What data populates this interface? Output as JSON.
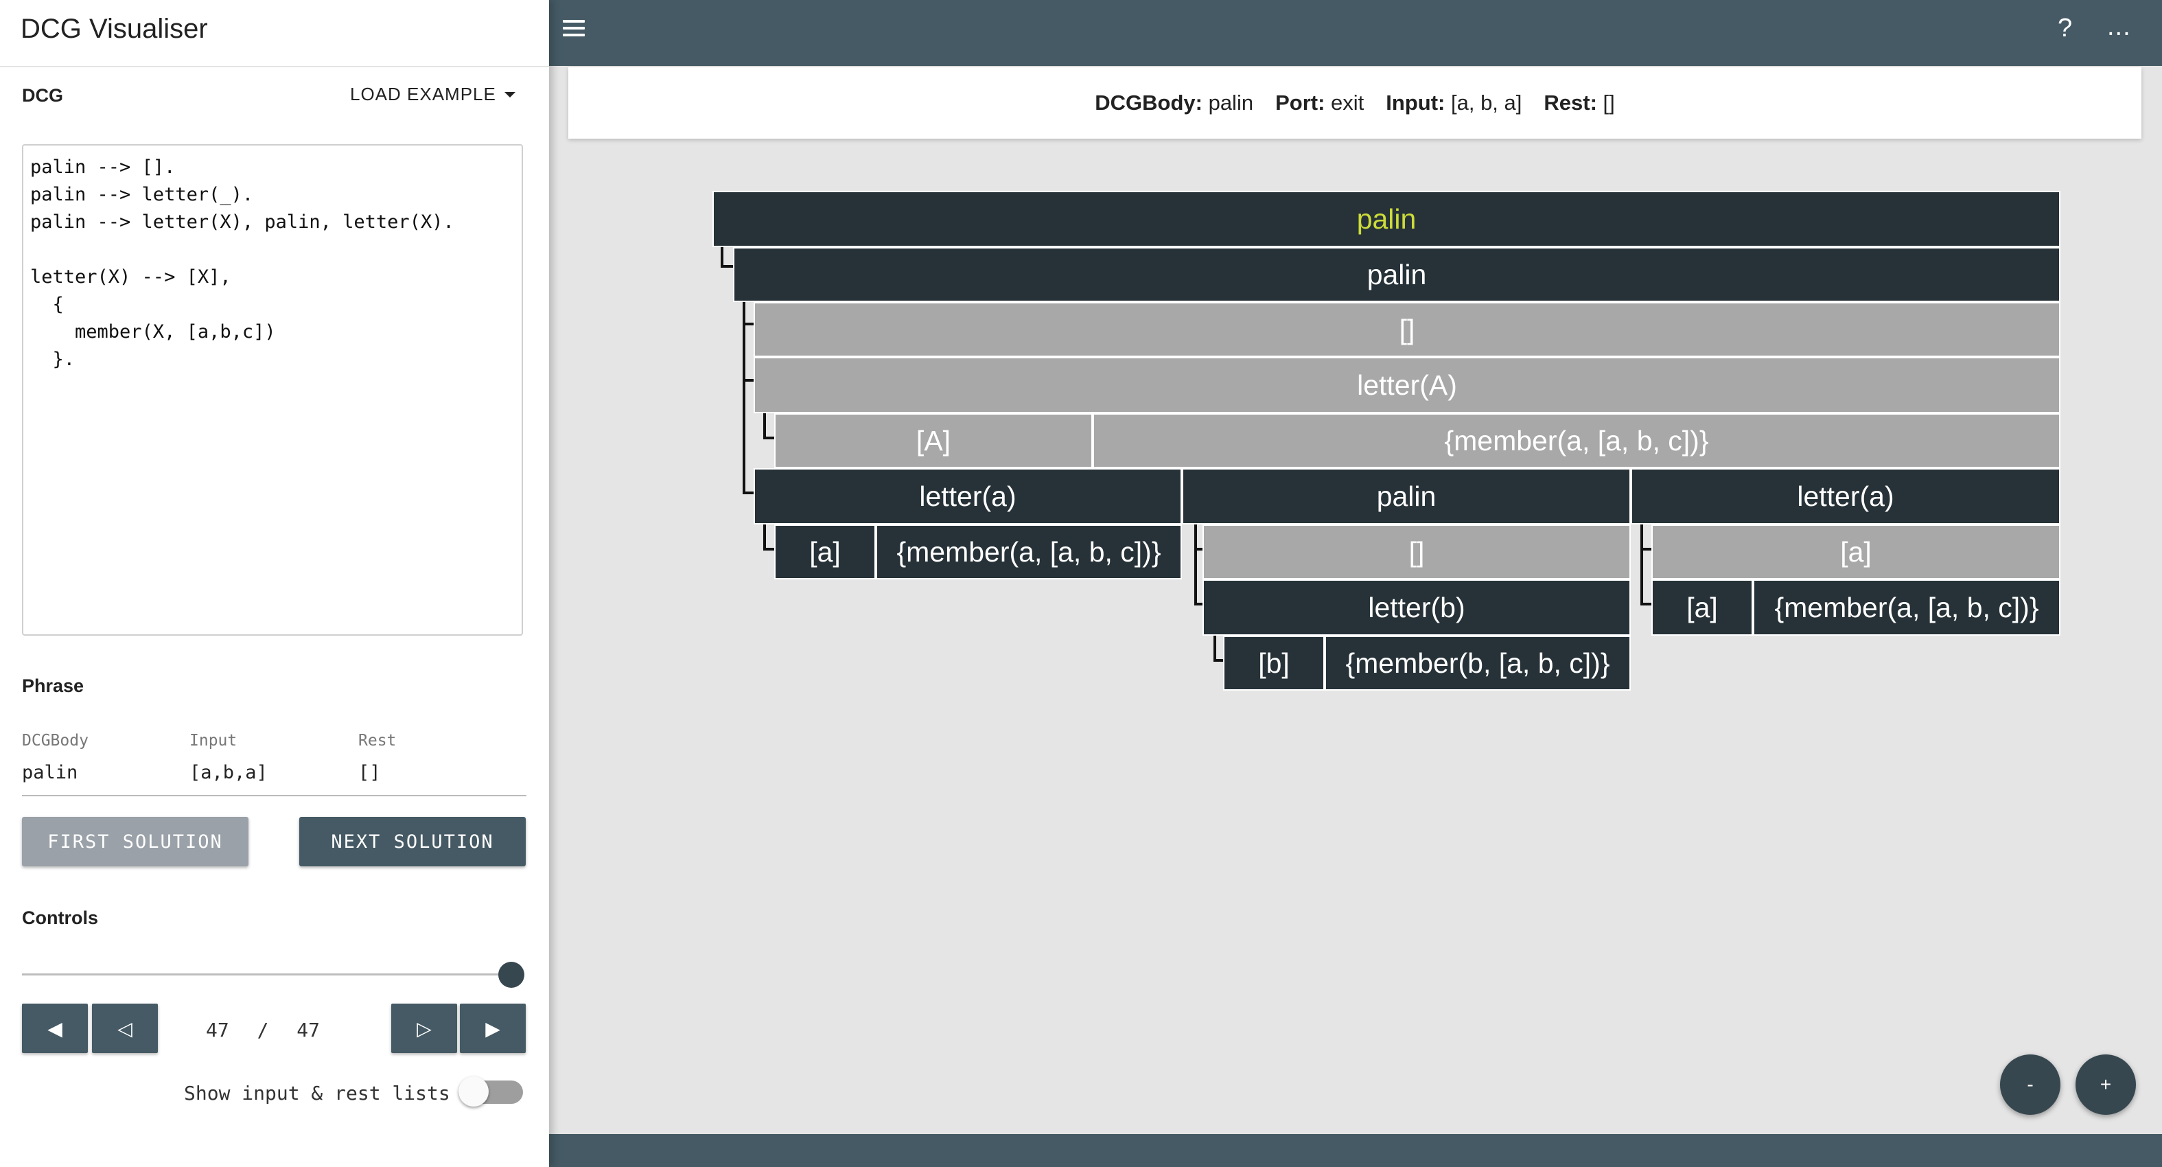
{
  "app": {
    "title": "DCG Visualiser"
  },
  "left_panel": {
    "dcg_label": "DCG",
    "load_example_label": "LOAD EXAMPLE",
    "dcg_code": "palin --> [].\npalin --> letter(_).\npalin --> letter(X), palin, letter(X).\n\nletter(X) --> [X],\n  {\n    member(X, [a,b,c])\n  }.",
    "phrase_label": "Phrase",
    "phrase": {
      "dcgbody_label": "DCGBody",
      "dcgbody_value": "palin",
      "input_label": "Input",
      "input_value": "[a,b,a]",
      "rest_label": "Rest",
      "rest_value": "[]"
    },
    "first_solution_label": "FIRST SOLUTION",
    "next_solution_label": "NEXT SOLUTION",
    "controls_label": "Controls",
    "slider_value_fraction": 1.0,
    "nav": {
      "first_glyph": "◀",
      "prev_glyph": "◁",
      "next_glyph": "▷",
      "last_glyph": "▶"
    },
    "step_current": "47",
    "step_separator": "/",
    "step_total": "47",
    "toggle_label": "Show input & rest lists",
    "toggle_on": false
  },
  "topbar": {
    "menu_icon": "hamburger-menu-icon",
    "help_label": "?",
    "more_label": "..."
  },
  "status": {
    "dcgbody_key": "DCGBody:",
    "dcgbody_value": "palin",
    "port_key": "Port:",
    "port_value": "exit",
    "input_key": "Input:",
    "input_value": "[a, b, a]",
    "rest_key": "Rest:",
    "rest_value": "[]"
  },
  "tree": {
    "root": "palin",
    "palin": "palin",
    "empty": "[]",
    "letter_A": "letter(A)",
    "A_list": "[A]",
    "member_A": "{member(a, [a, b, c])}",
    "letter_a1": "letter(a)",
    "palin_inner": "palin",
    "letter_a2": "letter(a)",
    "a_list1": "[a]",
    "member_a1": "{member(a, [a, b, c])}",
    "empty_inner": "[]",
    "a_list_grey": "[a]",
    "letter_b": "letter(b)",
    "a_list2": "[a]",
    "member_a2": "{member(a, [a, b, c])}",
    "b_list": "[b]",
    "member_b": "{member(b, [a, b, c])}"
  },
  "zoom": {
    "out_label": "-",
    "in_label": "+"
  },
  "colors": {
    "topbar": "#455a64",
    "node_dark": "#263238",
    "node_grey": "#a8a8a8",
    "root_text": "#cddc39",
    "button_disabled": "#9aa1a8",
    "button_primary": "#455a64"
  }
}
